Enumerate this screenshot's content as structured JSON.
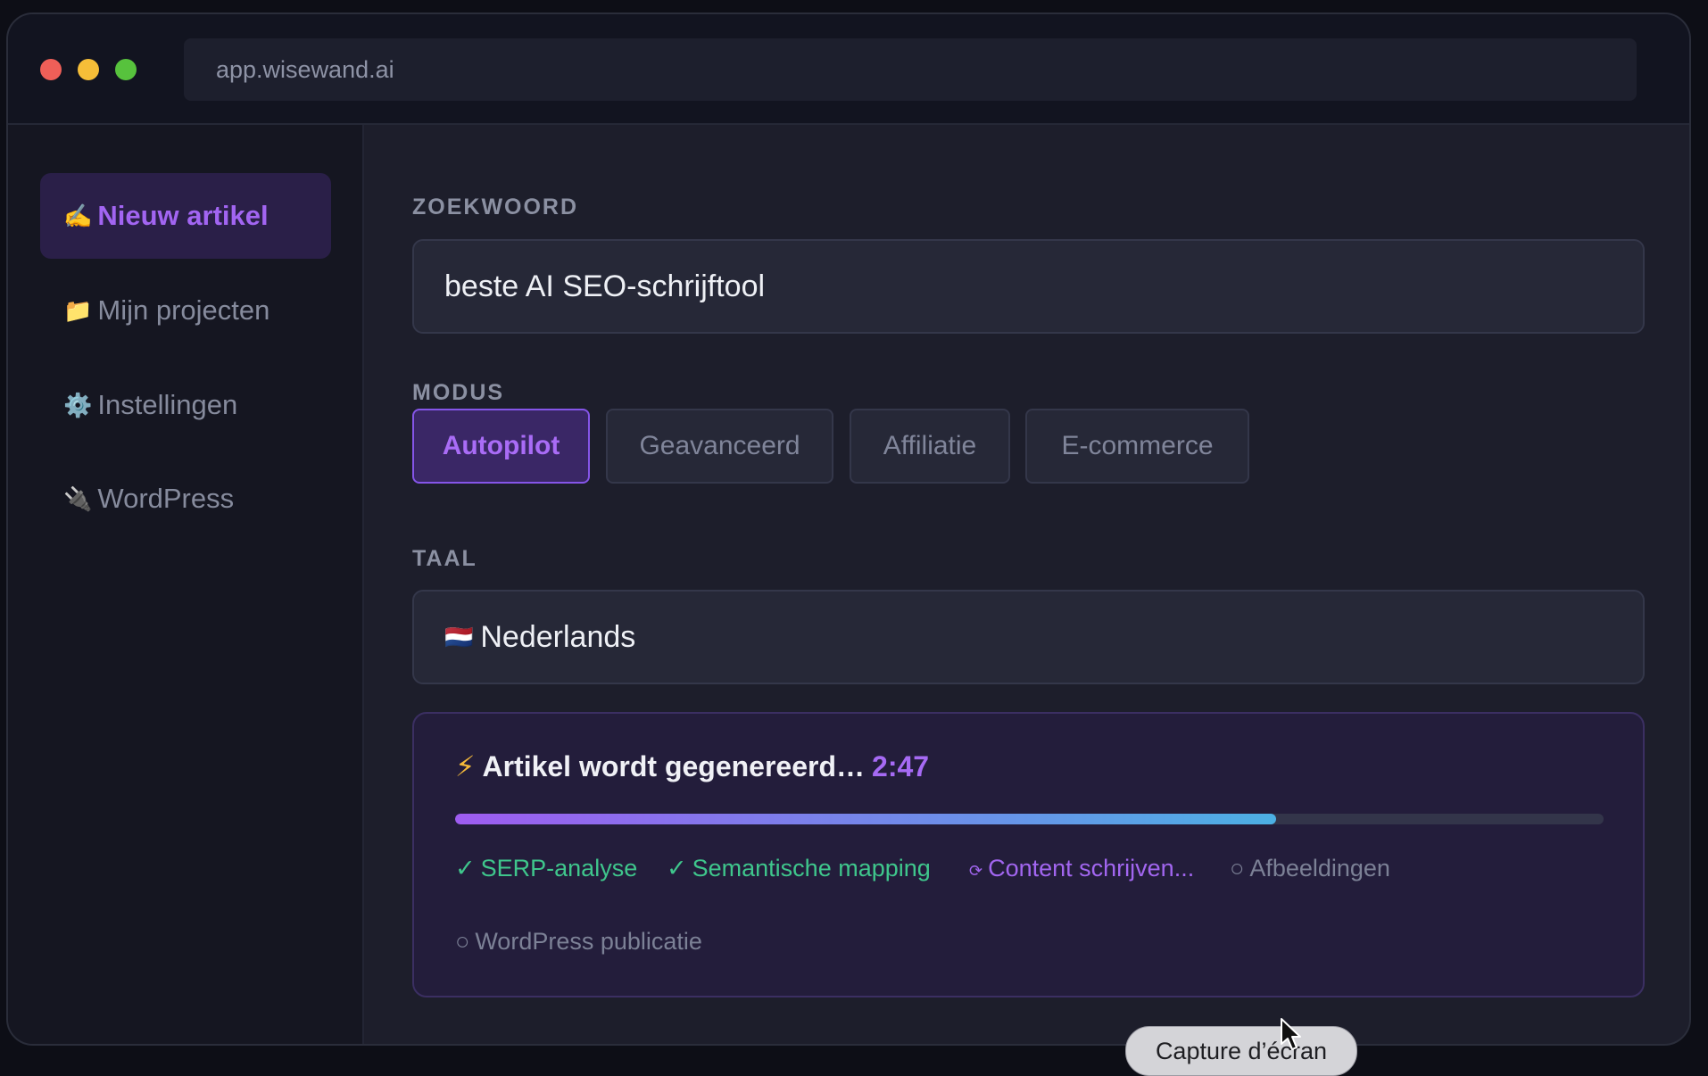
{
  "browser": {
    "url": "app.wisewand.ai"
  },
  "sidebar": {
    "items": [
      {
        "icon": "✍️",
        "label": "Nieuw artikel",
        "active": true
      },
      {
        "icon": "📁",
        "label": "Mijn projecten",
        "active": false
      },
      {
        "icon": "⚙️",
        "label": "Instellingen",
        "active": false
      },
      {
        "icon": "🔌",
        "label": "WordPress",
        "active": false
      }
    ]
  },
  "form": {
    "keyword_label": "ZOEKWOORD",
    "keyword_value": "beste AI SEO-schrijftool",
    "mode_label": "MODUS",
    "modes": [
      "Autopilot",
      "Geavanceerd",
      "Affiliatie",
      "E-commerce"
    ],
    "selected_mode": "Autopilot",
    "language_label": "TAAL",
    "language_flag": "🇳🇱",
    "language_value": "Nederlands"
  },
  "generation": {
    "icon": "⚡",
    "title": "Artikel wordt gegenereerd…",
    "timer": "2:47",
    "progress": 0.715,
    "steps": [
      {
        "mark": "✓",
        "label": "SERP-analyse",
        "status": "done"
      },
      {
        "mark": "✓",
        "label": "Semantische mapping",
        "status": "done"
      },
      {
        "mark": "⟳",
        "label": "Content schrijven...",
        "status": "in-progress"
      },
      {
        "mark": "○",
        "label": "Afbeeldingen",
        "status": "pending"
      },
      {
        "mark": "○",
        "label": "WordPress publicatie",
        "status": "pending"
      }
    ],
    "colors": {
      "done": "#3fc68c",
      "in_progress": "#a266f0",
      "pending": "#7c8196",
      "accent": "#a66af4"
    }
  },
  "tooltip": {
    "label": "Capture d’écran"
  }
}
